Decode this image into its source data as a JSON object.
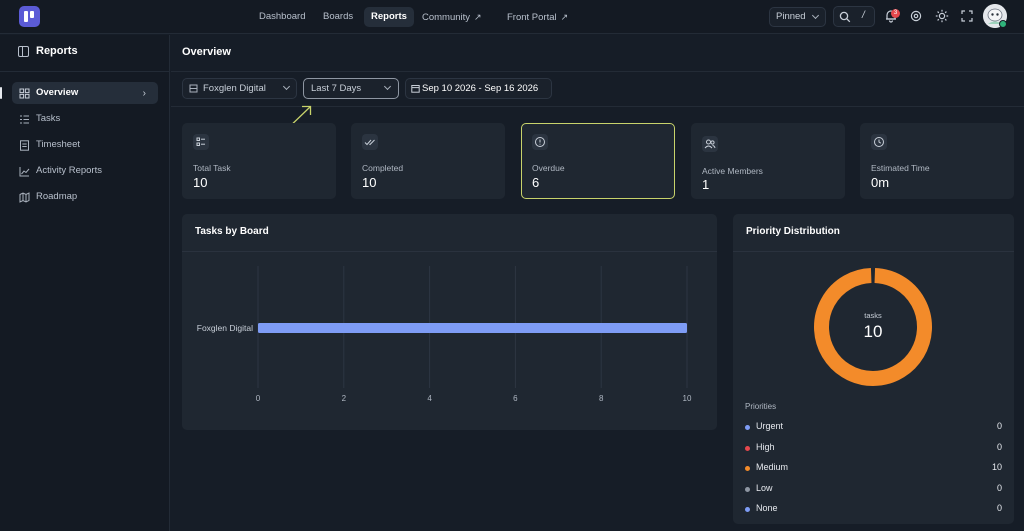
{
  "nav": {
    "items": [
      {
        "label": "Dashboard"
      },
      {
        "label": "Boards"
      },
      {
        "label": "Reports"
      },
      {
        "label": "Community"
      },
      {
        "label": "Front Portal"
      }
    ],
    "pinned_label": "Pinned",
    "search_shortcut": "/",
    "notification_count": "3"
  },
  "sidebar": {
    "title": "Reports",
    "items": [
      {
        "label": "Overview",
        "icon": "grid-icon"
      },
      {
        "label": "Tasks",
        "icon": "list-icon"
      },
      {
        "label": "Timesheet",
        "icon": "document-icon"
      },
      {
        "label": "Activity Reports",
        "icon": "trend-icon"
      },
      {
        "label": "Roadmap",
        "icon": "map-icon"
      }
    ]
  },
  "main": {
    "title": "Overview",
    "filters": {
      "workspace": "Foxglen Digital",
      "period": "Last 7 Days",
      "date_range": "Sep 10 2026 - Sep 16 2026"
    },
    "stats": [
      {
        "label": "Total Task",
        "value": "10"
      },
      {
        "label": "Completed",
        "value": "10"
      },
      {
        "label": "Overdue",
        "value": "6"
      },
      {
        "label": "Active Members",
        "value": "1"
      },
      {
        "label": "Estimated Time",
        "value": "0m"
      }
    ]
  },
  "tasks_by_board": {
    "title": "Tasks by Board"
  },
  "priority_distribution": {
    "title": "Priority Distribution",
    "center_label": "tasks",
    "center_value": "10",
    "list_heading": "Priorities",
    "items": [
      {
        "name": "Urgent",
        "count": "0",
        "color": "#7e9cf5"
      },
      {
        "name": "High",
        "count": "0",
        "color": "#e5484d"
      },
      {
        "name": "Medium",
        "count": "10",
        "color": "#f38b2a"
      },
      {
        "name": "Low",
        "count": "0",
        "color": "#8e96a2"
      },
      {
        "name": "None",
        "count": "0",
        "color": "#7e9cf5"
      }
    ]
  },
  "colors": {
    "accent": "#5b5bd6",
    "bar": "#7e9cf5",
    "donut": "#f38b2a",
    "highlight_border": "#c8d36b"
  },
  "chart_data": [
    {
      "type": "bar",
      "orientation": "horizontal",
      "title": "Tasks by Board",
      "categories": [
        "Foxglen Digital"
      ],
      "values": [
        10
      ],
      "xlim": [
        0,
        10
      ],
      "xticks": [
        0,
        2,
        4,
        6,
        8,
        10
      ],
      "grid": true
    },
    {
      "type": "pie",
      "title": "Priority Distribution",
      "categories": [
        "Urgent",
        "High",
        "Medium",
        "Low",
        "None"
      ],
      "values": [
        0,
        0,
        10,
        0,
        0
      ],
      "donut": true
    }
  ]
}
